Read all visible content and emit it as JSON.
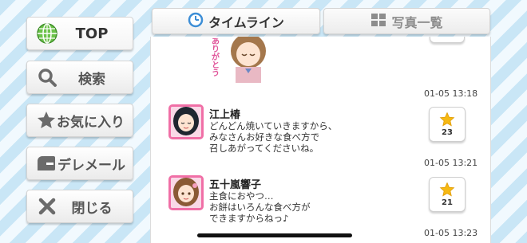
{
  "nav": {
    "top_label": "TOP",
    "search_label": "検索",
    "favorites_label": "お気に入り",
    "deremail_label": "デレメール",
    "close_label": "閉じる"
  },
  "tabs": {
    "timeline_label": "タイムライン",
    "photos_label": "写真一覧"
  },
  "colors": {
    "accent_pink": "#f06fa6",
    "star_gold": "#f6b913",
    "background_stripe": "#c9e6f6"
  },
  "timeline": {
    "first_image_text": "ありがとう",
    "posts": [
      {
        "time": "01-05 13:18"
      },
      {
        "name": "江上椿",
        "lines": [
          "どんどん焼いていきますから、",
          "みなさんお好きな食べ方で",
          "召しあがってくださいね。"
        ],
        "likes": "23",
        "time": "01-05 13:21"
      },
      {
        "name": "五十嵐響子",
        "lines": [
          "主食におやつ…",
          "お餅はいろんな食べ方が",
          "できますからねっ♪"
        ],
        "likes": "21",
        "time": "01-05 13:23"
      }
    ]
  }
}
